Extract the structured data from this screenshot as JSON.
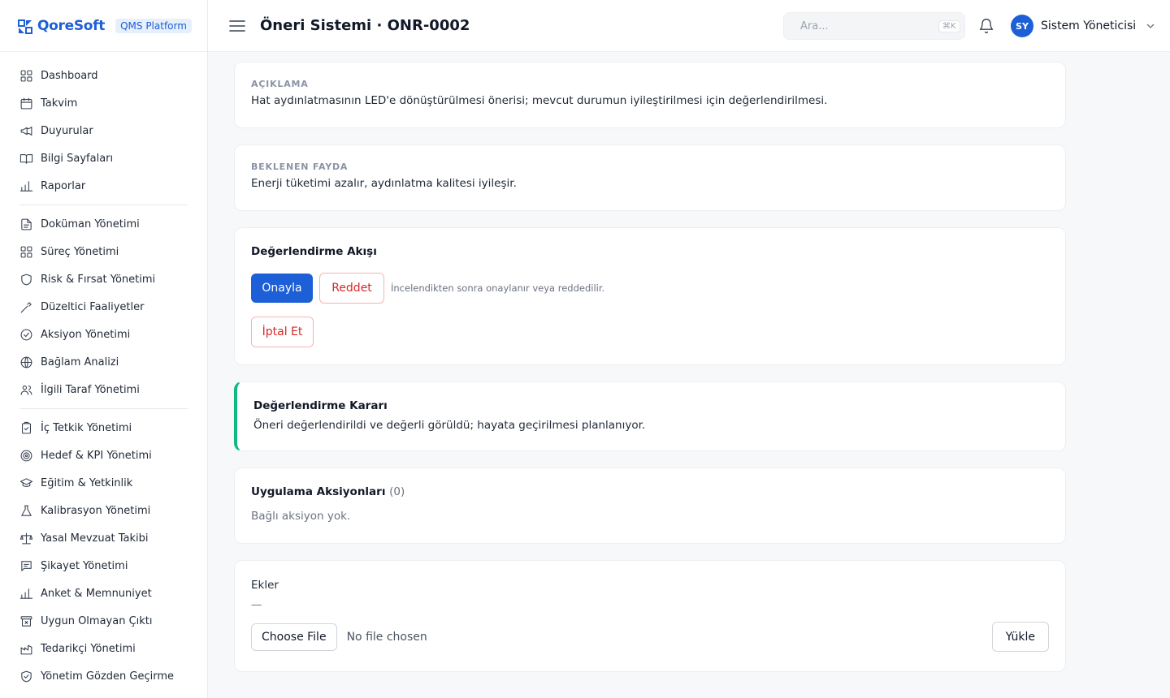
{
  "brand": {
    "name": "QoreSoft",
    "platform": "QMS Platform"
  },
  "sidebar": {
    "groups": [
      [
        {
          "label": "Dashboard",
          "icon": "grid-icon"
        },
        {
          "label": "Takvim",
          "icon": "calendar-icon"
        },
        {
          "label": "Duyurular",
          "icon": "megaphone-icon"
        },
        {
          "label": "Bilgi Sayfaları",
          "icon": "book-icon"
        },
        {
          "label": "Raporlar",
          "icon": "bar-chart-icon"
        }
      ],
      [
        {
          "label": "Doküman Yönetimi",
          "icon": "document-icon"
        },
        {
          "label": "Süreç Yönetimi",
          "icon": "grid-icon"
        },
        {
          "label": "Risk & Fırsat Yönetimi",
          "icon": "shield-icon"
        },
        {
          "label": "Düzeltici Faaliyetler",
          "icon": "wrench-icon"
        },
        {
          "label": "Aksiyon Yönetimi",
          "icon": "check-circle-icon"
        },
        {
          "label": "Bağlam Analizi",
          "icon": "globe-icon"
        },
        {
          "label": "İlgili Taraf Yönetimi",
          "icon": "users-icon"
        }
      ],
      [
        {
          "label": "İç Tetkik Yönetimi",
          "icon": "clipboard-check-icon"
        },
        {
          "label": "Hedef & KPI Yönetimi",
          "icon": "target-icon"
        },
        {
          "label": "Eğitim & Yetkinlik",
          "icon": "graduation-cap-icon"
        },
        {
          "label": "Kalibrasyon Yönetimi",
          "icon": "flask-icon"
        },
        {
          "label": "Yasal Mevzuat Takibi",
          "icon": "scale-icon"
        },
        {
          "label": "Şikayet Yönetimi",
          "icon": "message-icon"
        },
        {
          "label": "Anket & Memnuniyet",
          "icon": "bar-chart-icon"
        },
        {
          "label": "Uygun Olmayan Çıktı",
          "icon": "archive-x-icon"
        },
        {
          "label": "Tedarikçi Yönetimi",
          "icon": "factory-icon"
        },
        {
          "label": "Yönetim Gözden Geçirme",
          "icon": "shield-check-icon"
        }
      ]
    ]
  },
  "header": {
    "title": "Öneri Sistemi · ONR-0002",
    "search_placeholder": "Ara...",
    "search_shortcut": "⌘K",
    "user_initials": "SY",
    "user_name": "Sistem Yöneticisi"
  },
  "description": {
    "label": "AÇIKLAMA",
    "text": "Hat aydınlatmasının LED'e dönüştürülmesi önerisi; mevcut durumun iyileştirilmesi için değerlendirilmesi."
  },
  "benefit": {
    "label": "BEKLENEN FAYDA",
    "text": "Enerji tüketimi azalır, aydınlatma kalitesi iyileşir."
  },
  "workflow": {
    "title": "Değerlendirme Akışı",
    "approve_label": "Onayla",
    "reject_label": "Reddet",
    "hint": "İncelendikten sonra onaylanır veya reddedilir.",
    "cancel_label": "İptal Et"
  },
  "decision": {
    "title": "Değerlendirme Kararı",
    "text": "Öneri değerlendirildi ve değerli görüldü; hayata geçirilmesi planlanıyor."
  },
  "actions": {
    "title": "Uygulama Aksiyonları",
    "count": "(0)",
    "empty": "Bağlı aksiyon yok."
  },
  "attachments": {
    "title": "Ekler",
    "empty_dash": "—",
    "choose_label": "Choose File",
    "no_file": "No file chosen",
    "upload_label": "Yükle"
  },
  "colors": {
    "primary": "#1d5fd6",
    "danger": "#dc2626",
    "success": "#10b981"
  }
}
